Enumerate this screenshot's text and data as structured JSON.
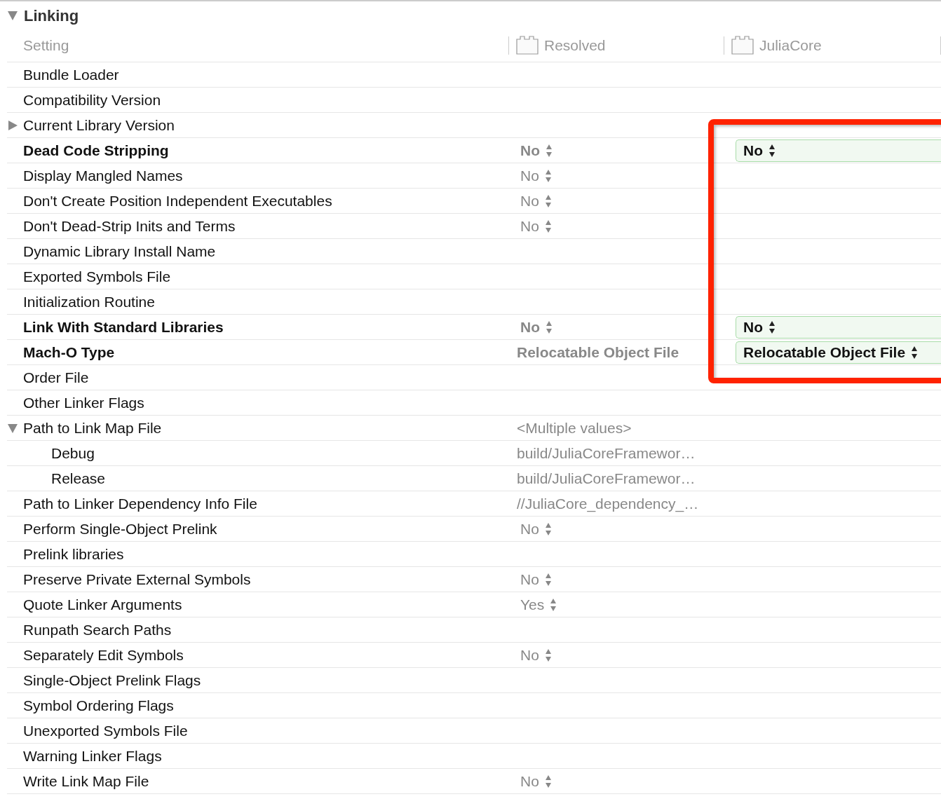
{
  "section": {
    "title": "Linking",
    "expanded": true
  },
  "columns": [
    "Setting",
    "Resolved",
    "JuliaCore"
  ],
  "rows": [
    {
      "name": "Bundle Loader",
      "bold": false
    },
    {
      "name": "Compatibility Version",
      "bold": false
    },
    {
      "name": "Current Library Version",
      "bold": false,
      "expanded": false
    },
    {
      "name": "Dead Code Stripping",
      "bold": true,
      "resolved": {
        "kind": "popup",
        "text": "No"
      },
      "target": {
        "kind": "popup",
        "text": "No"
      }
    },
    {
      "name": "Display Mangled Names",
      "bold": false,
      "resolved": {
        "kind": "popup",
        "text": "No"
      }
    },
    {
      "name": "Don't Create Position Independent Executables",
      "bold": false,
      "resolved": {
        "kind": "popup",
        "text": "No"
      }
    },
    {
      "name": "Don't Dead-Strip Inits and Terms",
      "bold": false,
      "resolved": {
        "kind": "popup",
        "text": "No"
      }
    },
    {
      "name": "Dynamic Library Install Name",
      "bold": false
    },
    {
      "name": "Exported Symbols File",
      "bold": false
    },
    {
      "name": "Initialization Routine",
      "bold": false
    },
    {
      "name": "Link With Standard Libraries",
      "bold": true,
      "resolved": {
        "kind": "popup",
        "text": "No"
      },
      "target": {
        "kind": "popup",
        "text": "No"
      }
    },
    {
      "name": "Mach-O Type",
      "bold": true,
      "resolved": {
        "kind": "text",
        "text": "Relocatable Object File"
      },
      "target": {
        "kind": "popup",
        "text": "Relocatable Object File"
      }
    },
    {
      "name": "Order File",
      "bold": false
    },
    {
      "name": "Other Linker Flags",
      "bold": false
    },
    {
      "name": "Path to Link Map File",
      "bold": false,
      "expanded": true,
      "resolved": {
        "kind": "text",
        "text": "<Multiple values>"
      },
      "children": [
        {
          "name": "Debug",
          "bold": false,
          "resolved": {
            "kind": "text",
            "text": "build/JuliaCoreFramewor…"
          }
        },
        {
          "name": "Release",
          "bold": false,
          "resolved": {
            "kind": "text",
            "text": "build/JuliaCoreFramewor…"
          }
        }
      ]
    },
    {
      "name": "Path to Linker Dependency Info File",
      "bold": false,
      "resolved": {
        "kind": "text",
        "text": "//JuliaCore_dependency_…"
      }
    },
    {
      "name": "Perform Single-Object Prelink",
      "bold": false,
      "resolved": {
        "kind": "popup",
        "text": "No"
      }
    },
    {
      "name": "Prelink libraries",
      "bold": false
    },
    {
      "name": "Preserve Private External Symbols",
      "bold": false,
      "resolved": {
        "kind": "popup",
        "text": "No"
      }
    },
    {
      "name": "Quote Linker Arguments",
      "bold": false,
      "resolved": {
        "kind": "popup",
        "text": "Yes"
      }
    },
    {
      "name": "Runpath Search Paths",
      "bold": false
    },
    {
      "name": "Separately Edit Symbols",
      "bold": false,
      "resolved": {
        "kind": "popup",
        "text": "No"
      }
    },
    {
      "name": "Single-Object Prelink Flags",
      "bold": false
    },
    {
      "name": "Symbol Ordering Flags",
      "bold": false
    },
    {
      "name": "Unexported Symbols File",
      "bold": false
    },
    {
      "name": "Warning Linker Flags",
      "bold": false
    },
    {
      "name": "Write Link Map File",
      "bold": false,
      "resolved": {
        "kind": "popup",
        "text": "No"
      }
    }
  ]
}
